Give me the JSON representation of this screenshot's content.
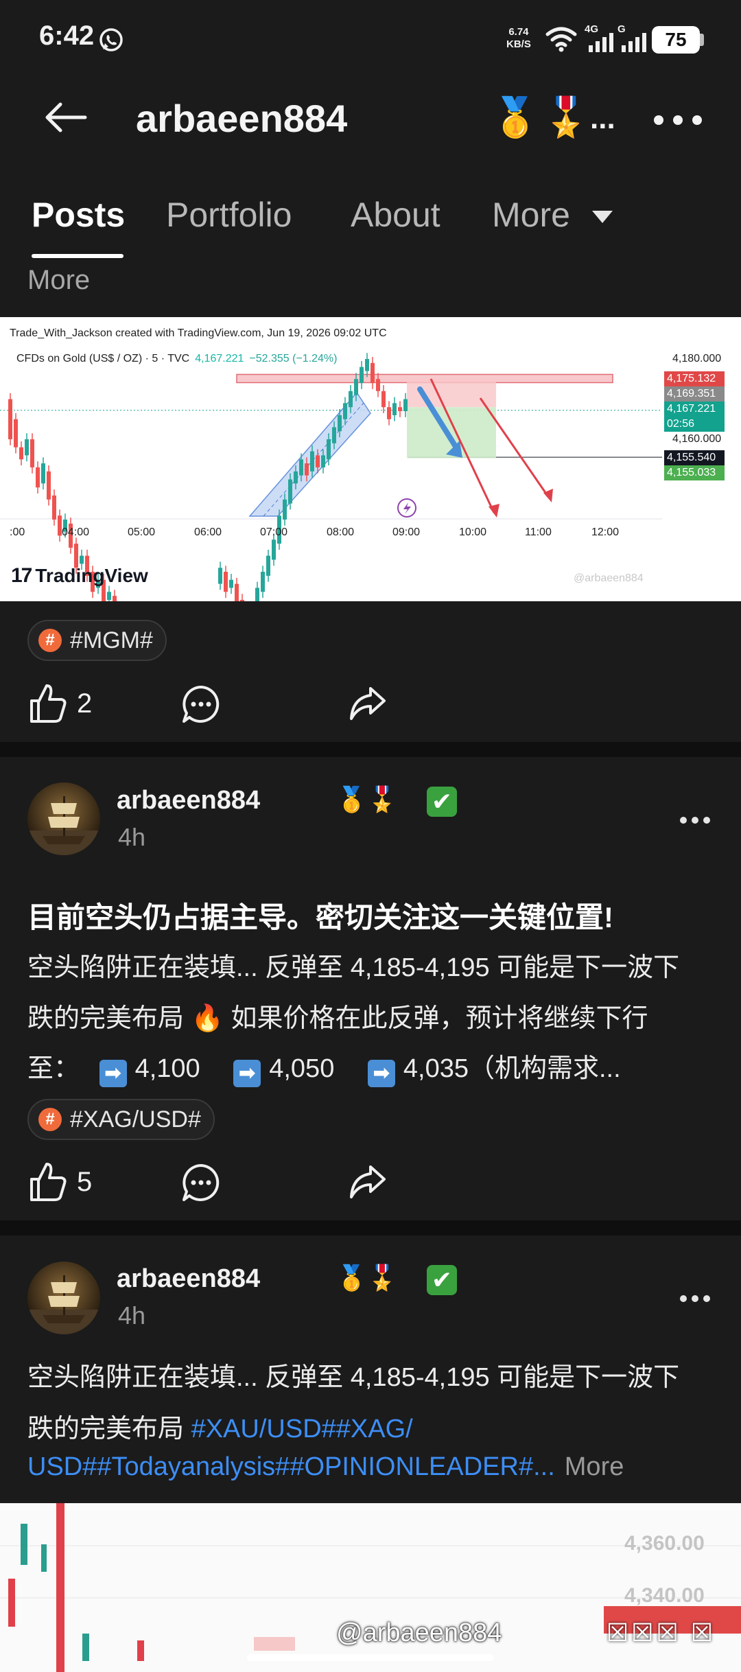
{
  "status_bar": {
    "time": "6:42",
    "net_speed_value": "6.74",
    "net_speed_unit": "KB/S",
    "signal1_label": "4G",
    "signal2_label": "G",
    "battery": "75"
  },
  "header": {
    "profile_name": "arbaeen884",
    "badges": [
      "🥇",
      "🎖️"
    ],
    "ellipsis": "..."
  },
  "tabs": {
    "posts": "Posts",
    "portfolio": "Portfolio",
    "about": "About",
    "more": "More",
    "more_second": "More"
  },
  "chart_card": {
    "title": "Trade_With_Jackson created with TradingView.com, Jun 19, 2026 09:02 UTC",
    "symbol": "CFDs on Gold (US$ / OZ) · 5 · TVC",
    "price": "4,167.221",
    "change": "−52.355 (−1.24%)",
    "axis_top": "4,180.000",
    "axis_mid": "4,160.000",
    "tags": [
      {
        "text": "4,175.132",
        "color": "#e04848"
      },
      {
        "text": "4,169.351",
        "color": "#8a8a8a"
      },
      {
        "text": "4,167.221",
        "color": "#12a28e"
      },
      {
        "text": "02:56",
        "color": "#12a28e"
      },
      {
        "text": "4,155.540",
        "color": "#131722"
      },
      {
        "text": "4,155.033",
        "color": "#4caf50"
      }
    ],
    "time_labels": [
      ":00",
      "04:00",
      "05:00",
      "06:00",
      "07:00",
      "08:00",
      "09:00",
      "10:00",
      "11:00",
      "12:00"
    ],
    "logo": "TradingView",
    "watermark": "@arbaeen884"
  },
  "chart_data": {
    "type": "candlestick",
    "title": "CFDs on Gold (US$ / OZ) · 5 · TVC",
    "x_ticks": [
      ":00",
      "04:00",
      "05:00",
      "06:00",
      "07:00",
      "08:00",
      "09:00",
      "10:00",
      "11:00",
      "12:00"
    ],
    "y_ticks": [
      4180,
      4160
    ],
    "last_price": 4167.221,
    "change": -52.355,
    "change_pct": -1.24,
    "levels": {
      "resistance_zone": 4175.132,
      "level_1": 4169.351,
      "level_2": 4155.54,
      "level_3": 4155.033
    },
    "annotations": [
      "rising channel 06:40–08:30",
      "short position box 09:00–10:00",
      "down arrows 09:15–11:10"
    ]
  },
  "posts": [
    {
      "hashtag": "#MGM#",
      "likes": "2"
    },
    {
      "author": "arbaeen884",
      "badges": "🥇🎖️",
      "verified": "✔",
      "time": "4h",
      "headline": "目前空头仍占据主导。密切关注这一关键位置!",
      "line1": "空头陷阱正在装填... 反弹至 4,185-4,195 可能是下一波下",
      "line2a": "跌的完美布局",
      "emoji_fire": "🔥",
      "line2b": "如果价格在此反弹，预计将继续下行",
      "line3_prefix": "至：",
      "arrow_glyph": "➡",
      "targets": [
        "4,100",
        "4,050",
        "4,035"
      ],
      "line3_suffix": "（机构需求...",
      "hashtag": "#XAG/USD#",
      "likes": "5"
    },
    {
      "author": "arbaeen884",
      "badges": "🥇🎖️",
      "verified": "✔",
      "time": "4h",
      "line1": "空头陷阱正在装填... 反弹至 4,185-4,195 可能是下一波下",
      "line2a": "跌的完美布局",
      "line2_link": "#XAU/USD##XAG/",
      "line3_link": "USD##Todayanalysis##OPINIONLEADER#...",
      "more": "More"
    }
  ],
  "preview": {
    "price1": "4,360.00",
    "price2": "4,340.00",
    "watermark": "@arbaeen884",
    "blocks": "☒☒☒ ☒"
  }
}
